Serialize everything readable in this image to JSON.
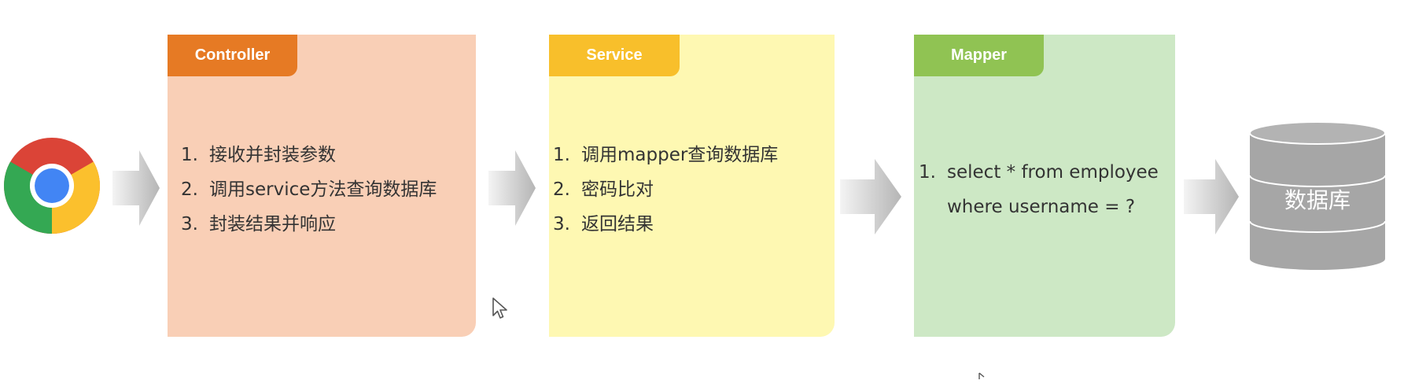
{
  "browser": {
    "icon": "chrome-browser-icon"
  },
  "controller": {
    "title": "Controller",
    "color": "#e67a24",
    "background": "#f9cfb6",
    "steps": [
      {
        "num": "1.",
        "text": "接收并封装参数"
      },
      {
        "num": "2.",
        "text": "调用service方法查询数据库"
      },
      {
        "num": "3.",
        "text": "封装结果并响应"
      }
    ]
  },
  "service": {
    "title": "Service",
    "color": "#f8bf2b",
    "background": "#fef8b2",
    "steps": [
      {
        "num": "1.",
        "text": "调用mapper查询数据库"
      },
      {
        "num": "2.",
        "text": "密码比对"
      },
      {
        "num": "3.",
        "text": "返回结果"
      }
    ]
  },
  "mapper": {
    "title": "Mapper",
    "color": "#90c353",
    "background": "#cde8c5",
    "steps": [
      {
        "num": "1.",
        "text": "select * from employee\nwhere username = ?"
      }
    ]
  },
  "database": {
    "label": "数据库",
    "color": "#a6a6a6",
    "icon": "database-icon"
  },
  "arrow_icon": "arrow-right-icon"
}
